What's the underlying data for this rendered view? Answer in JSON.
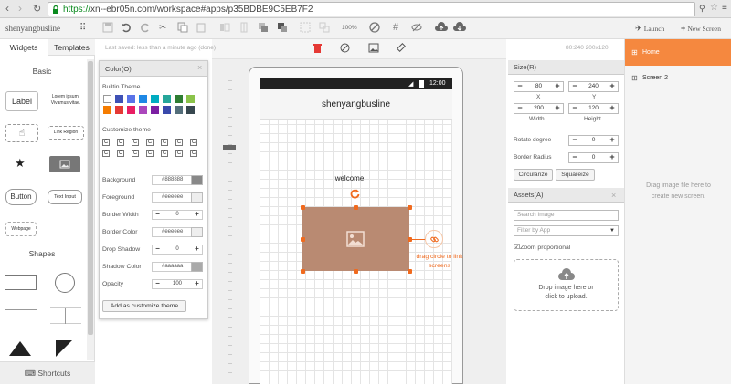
{
  "browser": {
    "url_scheme": "https://",
    "url_rest": "xn--ebr05n.com/workspace#apps/p35BDBE9C5EB7F2"
  },
  "toolbar": {
    "app_name": "shenyangbusline",
    "zoom": "100%",
    "launch_label": "Launch",
    "new_screen_label": "New Screen"
  },
  "status_bar": {
    "last_saved": "Last saved: less than a minute ago (done)",
    "coords": "80:240 200x120"
  },
  "left_panel": {
    "tabs": [
      "Widgets",
      "Templates"
    ],
    "basic_title": "Basic",
    "shapes_title": "Shapes",
    "widgets": {
      "label": "Label",
      "lorem": "Lorem ipsum.\nVivamus vitae.",
      "link_region": "Link Region",
      "button": "Button",
      "text_input": "Text Input",
      "webpage": "Webpage"
    },
    "shortcuts": "Shortcuts"
  },
  "color_panel": {
    "title": "Color(O)",
    "builtin_theme": "Builtin Theme",
    "customize_theme": "Customize theme",
    "builtin_colors_row1": [
      "#ffffff",
      "#3f51b5",
      "#5a73e8",
      "#1e88e5",
      "#00acc1",
      "#26a69a",
      "#2e7d32",
      "#8bc34a"
    ],
    "builtin_colors_row2": [
      "#f57c00",
      "#e53935",
      "#e91e63",
      "#ab47bc",
      "#7b1fa2",
      "#3949ab",
      "#546e7a",
      "#37474f"
    ],
    "custom_cell_label": "C",
    "fields": [
      {
        "label": "Background",
        "value": "#888888",
        "swatch": "#888888"
      },
      {
        "label": "Foreground",
        "value": "#eeeeee",
        "swatch": "#eeeeee"
      },
      {
        "label": "Border Width",
        "value": "0"
      },
      {
        "label": "Border Color",
        "value": "#eeeeee",
        "swatch": "#eeeeee"
      },
      {
        "label": "Drop Shadow",
        "value": "0"
      },
      {
        "label": "Shadow Color",
        "value": "#aaaaaa",
        "swatch": "#aaaaaa"
      },
      {
        "label": "Opacity",
        "value": "100"
      }
    ],
    "add_button": "Add as customize theme"
  },
  "phone": {
    "time": "12:00",
    "title": "shenyangbusline",
    "welcome": "welcome",
    "link_hint": "drag circle to link\nscreens",
    "image_color": "#b98a72",
    "accent": "#f06a1e"
  },
  "size_panel": {
    "title": "Size(R)",
    "x": "80",
    "y": "240",
    "width": "200",
    "height": "120",
    "x_label": "X",
    "y_label": "Y",
    "width_label": "Width",
    "height_label": "Height",
    "rotate_label": "Rotate degree",
    "rotate": "0",
    "radius_label": "Border Radius",
    "radius": "0",
    "circularize": "Circularize",
    "squareize": "Squareize"
  },
  "assets_panel": {
    "title": "Assets(A)",
    "search_placeholder": "Search Image",
    "filter": "Filter by App",
    "zoom_label": "Zoom proportional",
    "drop_text": "Drop image here or\nclick to upload."
  },
  "screens_panel": {
    "items": [
      "Home",
      "Screen 2"
    ],
    "drag_hint": "Drag image file here to\ncreate new screen."
  }
}
